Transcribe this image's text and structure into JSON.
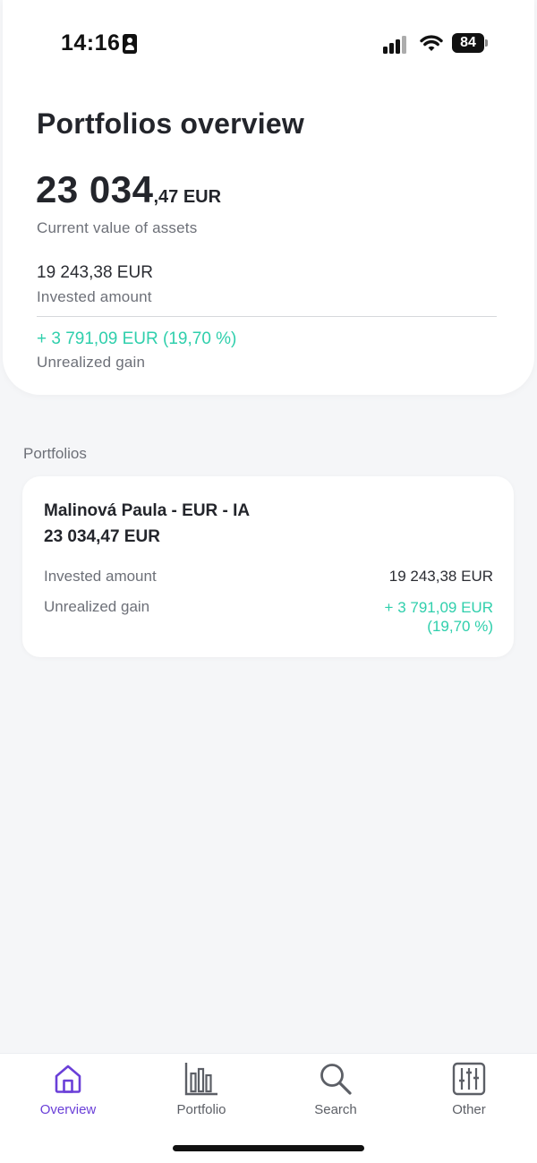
{
  "status_bar": {
    "time": "14:16",
    "battery": "84",
    "icons": [
      "id-card-icon",
      "signal-icon",
      "wifi-icon",
      "battery-icon"
    ]
  },
  "summary": {
    "title": "Portfolios overview",
    "total_main": "23 034",
    "total_decimal": ",47",
    "total_currency": " EUR",
    "current_label": "Current value of assets",
    "invested_value": "19 243,38 EUR",
    "invested_label": "Invested amount",
    "gain_value": "+ 3 791,09 EUR (19,70 %)",
    "gain_label": "Unrealized gain"
  },
  "portfolios": {
    "heading": "Portfolios",
    "items": [
      {
        "name": "Malinová Paula - EUR - IA",
        "total": "23 034,47 EUR",
        "invested_label": "Invested amount",
        "invested_value": "19 243,38 EUR",
        "gain_label": "Unrealized gain",
        "gain_value_line1": "+ 3 791,09 EUR",
        "gain_value_line2": "(19,70 %)"
      }
    ]
  },
  "bottom_nav": {
    "items": [
      {
        "label": "Overview",
        "icon": "home-icon",
        "active": true
      },
      {
        "label": "Portfolio",
        "icon": "bar-chart-icon",
        "active": false
      },
      {
        "label": "Search",
        "icon": "search-icon",
        "active": false
      },
      {
        "label": "Other",
        "icon": "sliders-icon",
        "active": false
      }
    ]
  },
  "colors": {
    "accent": "#6a3fd8",
    "gain": "#2fcfac",
    "text": "#23252b",
    "muted": "#6d7078",
    "background": "#f5f6f8"
  }
}
